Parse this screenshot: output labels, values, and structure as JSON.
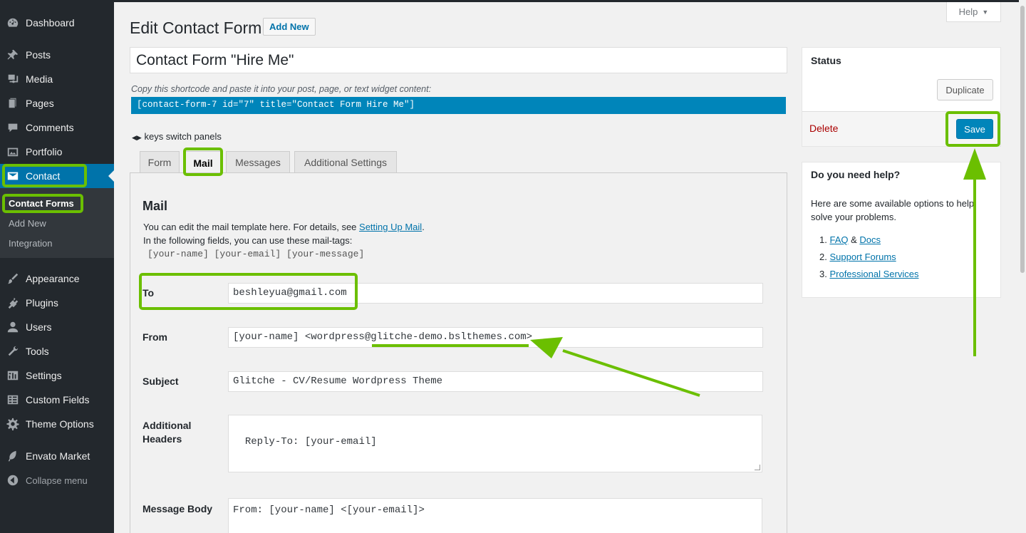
{
  "sidebar": {
    "items": [
      {
        "label": "Dashboard",
        "icon": "dashboard-icon"
      },
      {
        "label": "Posts",
        "icon": "pin-icon"
      },
      {
        "label": "Media",
        "icon": "media-icon"
      },
      {
        "label": "Pages",
        "icon": "pages-icon"
      },
      {
        "label": "Comments",
        "icon": "comment-icon"
      },
      {
        "label": "Portfolio",
        "icon": "portfolio-icon"
      },
      {
        "label": "Contact",
        "icon": "mail-icon"
      },
      {
        "label": "Appearance",
        "icon": "brush-icon"
      },
      {
        "label": "Plugins",
        "icon": "plugin-icon"
      },
      {
        "label": "Users",
        "icon": "user-icon"
      },
      {
        "label": "Tools",
        "icon": "wrench-icon"
      },
      {
        "label": "Settings",
        "icon": "settings-icon"
      },
      {
        "label": "Custom Fields",
        "icon": "table-icon"
      },
      {
        "label": "Theme Options",
        "icon": "gear-icon"
      },
      {
        "label": "Envato Market",
        "icon": "leaf-icon"
      },
      {
        "label": "Collapse menu",
        "icon": "collapse-icon"
      }
    ],
    "submenu": [
      "Contact Forms",
      "Add New",
      "Integration"
    ]
  },
  "header": {
    "help_label": "Help",
    "page_title": "Edit Contact Form",
    "add_new_label": "Add New"
  },
  "form": {
    "title_value": "Contact Form \"Hire Me\"",
    "shortcode_hint": "Copy this shortcode and paste it into your post, page, or text widget content:",
    "shortcode": "[contact-form-7 id=\"7\" title=\"Contact Form Hire Me\"]",
    "keys_hint": "keys switch panels"
  },
  "tabs": [
    {
      "label": "Form"
    },
    {
      "label": "Mail"
    },
    {
      "label": "Messages"
    },
    {
      "label": "Additional Settings"
    }
  ],
  "mail": {
    "title": "Mail",
    "desc_1": "You can edit the mail template here. For details, see ",
    "desc_link": "Setting Up Mail",
    "desc_1_end": ".",
    "desc_2": "In the following fields, you can use these mail-tags:",
    "tags": "[your-name] [your-email] [your-message]",
    "fields": {
      "to_label": "To",
      "to_value": "beshleyua@gmail.com",
      "from_label": "From",
      "from_value": "[your-name] <wordpress@glitche-demo.bslthemes.com>",
      "subject_label": "Subject",
      "subject_value": "Glitche - CV/Resume Wordpress Theme",
      "headers_label_1": "Additional",
      "headers_label_2": "Headers",
      "headers_value": "Reply-To: [your-email]",
      "body_label": "Message Body",
      "body_value": "From: [your-name] <[your-email]>\n\nMessage Body:"
    }
  },
  "status_box": {
    "title": "Status",
    "duplicate_label": "Duplicate",
    "delete_label": "Delete",
    "save_label": "Save"
  },
  "help_box": {
    "title": "Do you need help?",
    "text_1": "Here are some available options to help",
    "text_2": "solve your problems.",
    "faq": "FAQ",
    "amp": "&",
    "docs": "Docs",
    "support": "Support Forums",
    "professional": "Professional Services",
    "n1": "1.",
    "n2": "2.",
    "n3": "3."
  },
  "colors": {
    "highlight": "#6bbf00",
    "accent": "#0073aa",
    "sidebar": "#23282d",
    "shortcode_bg": "#0085ba"
  }
}
